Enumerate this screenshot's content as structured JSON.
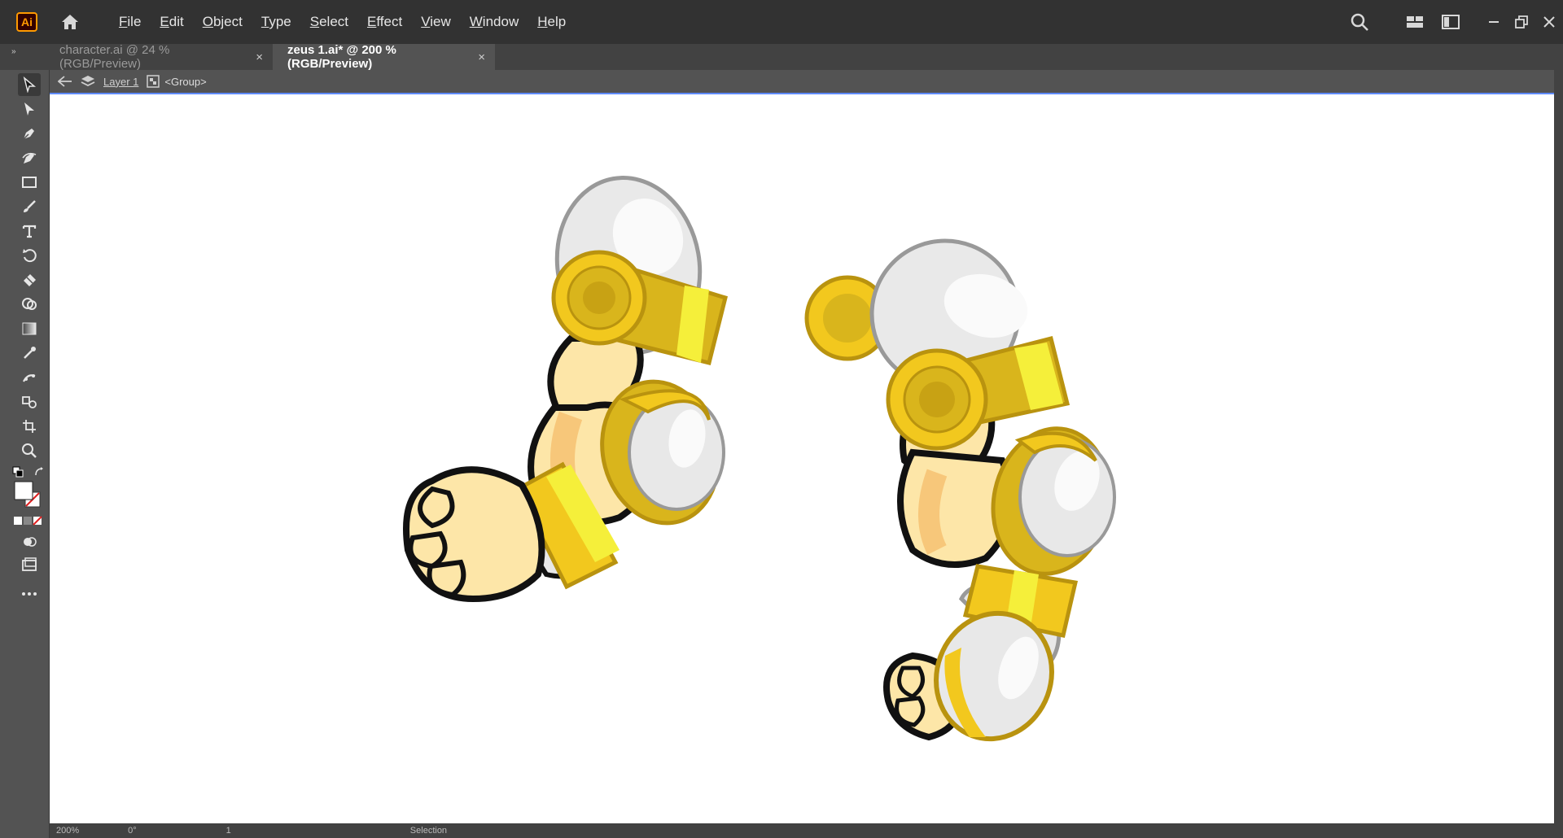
{
  "app": {
    "logo": "Ai"
  },
  "menu": [
    "File",
    "Edit",
    "Object",
    "Type",
    "Select",
    "Effect",
    "View",
    "Window",
    "Help"
  ],
  "tabs": [
    {
      "label": "character.ai @ 24 % (RGB/Preview)",
      "close": "×",
      "active": false
    },
    {
      "label": "zeus 1.ai* @ 200 % (RGB/Preview)",
      "close": "×",
      "active": true
    }
  ],
  "isolation": {
    "layer": "Layer 1",
    "group": "<Group>"
  },
  "status": {
    "zoom": "200%",
    "angle": "0°",
    "artboard": "1",
    "tool": "Selection"
  },
  "icons": {
    "home": "home-icon",
    "search": "search-icon",
    "arrange": "arrange-documents-icon",
    "workspace": "workspace-switcher-icon",
    "minimize": "minimize-icon",
    "restore": "restore-icon",
    "close": "close-icon"
  },
  "tools": [
    "selection-tool",
    "direct-selection-tool",
    "pen-tool",
    "curvature-tool",
    "rectangle-tool",
    "paintbrush-tool",
    "type-tool",
    "rotate-tool",
    "eraser-tool",
    "shape-builder-tool",
    "gradient-tool",
    "eyedropper-tool",
    "puppet-warp-tool",
    "symbol-sprayer-tool",
    "artboard-tool",
    "zoom-tool"
  ],
  "colors": {
    "accent": "#5f8bff",
    "gold": "#f2c81e",
    "gold_dark": "#b9930f",
    "skin": "#fde6a8",
    "skin_shadow": "#f7c77a",
    "silver": "#e8e8e8",
    "outline": "#111111"
  }
}
